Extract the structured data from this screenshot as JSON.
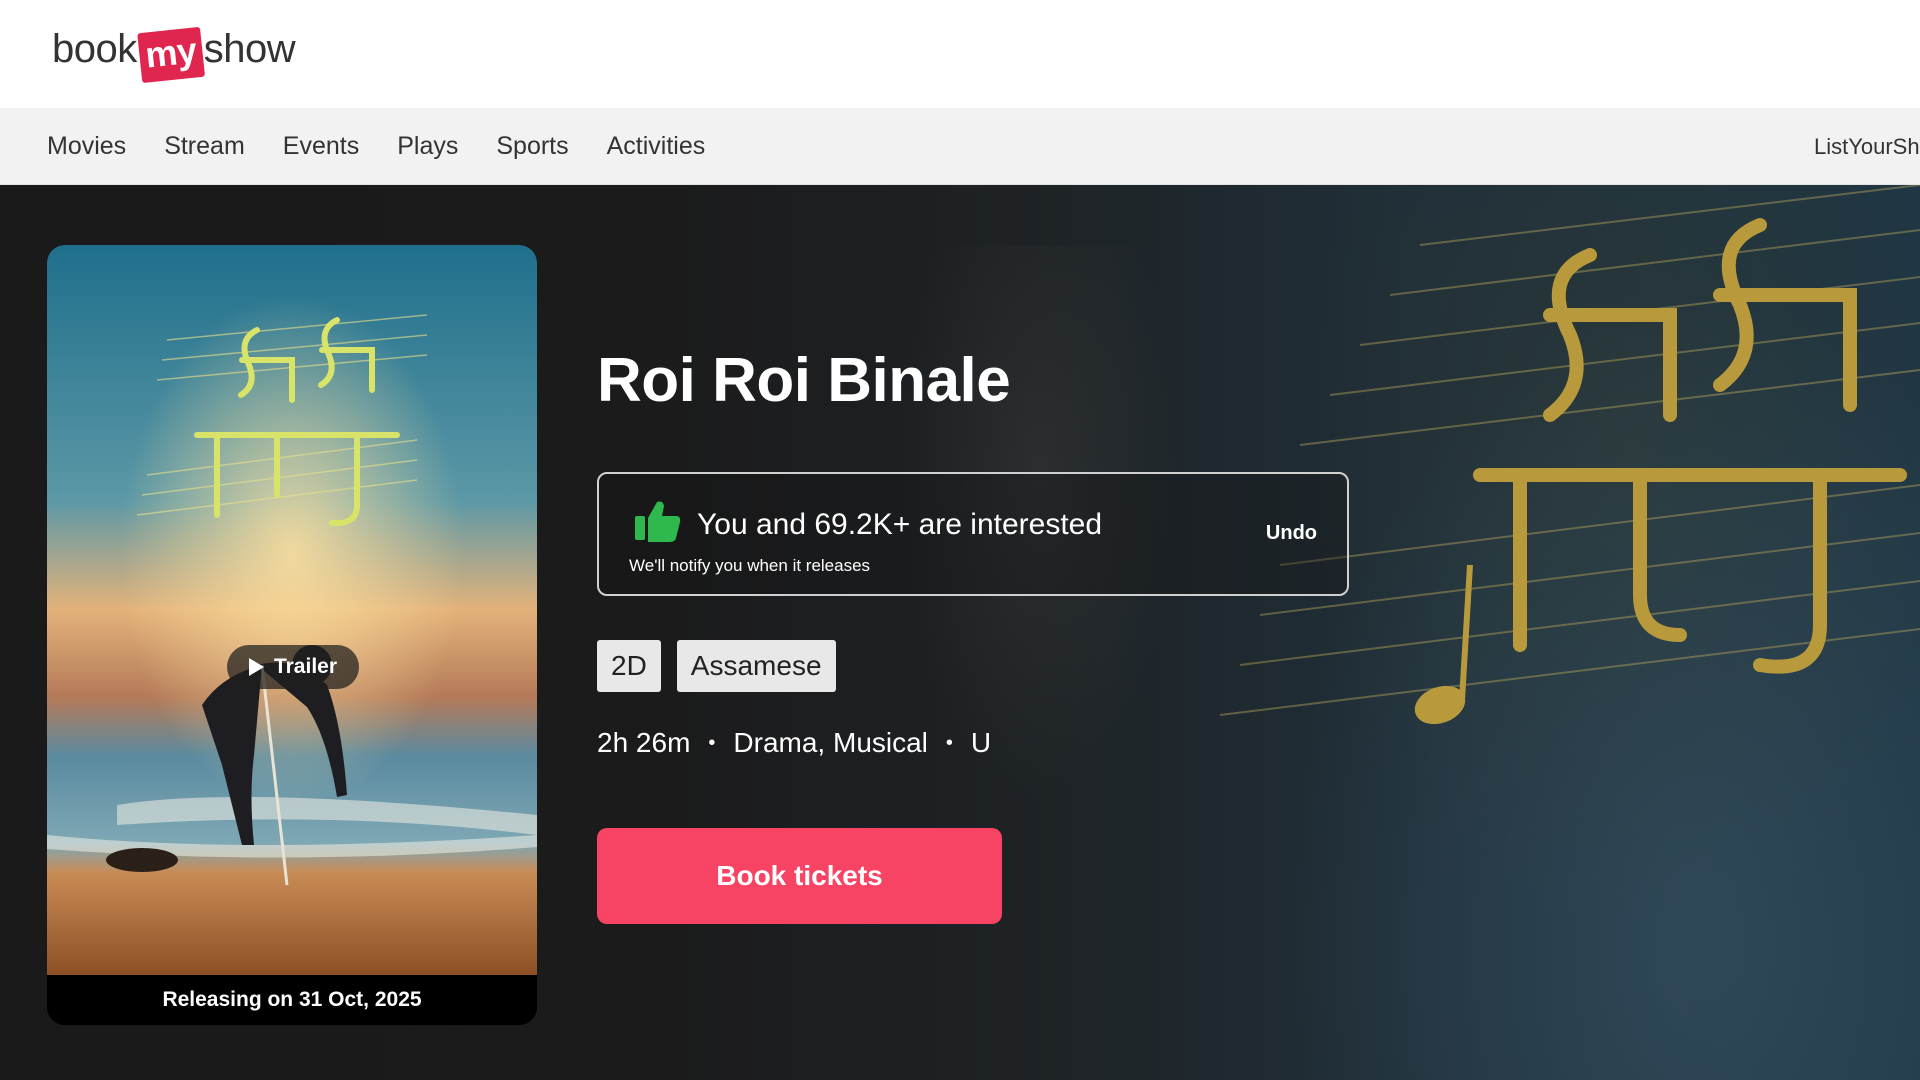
{
  "header": {
    "logo": {
      "part1": "book",
      "part2": "my",
      "part3": "show"
    }
  },
  "nav": {
    "items": [
      "Movies",
      "Stream",
      "Events",
      "Plays",
      "Sports",
      "Activities"
    ],
    "right_label": "ListYourSh"
  },
  "movie": {
    "title": "Roi Roi Binale",
    "trailer_label": "Trailer",
    "release_text": "Releasing on 31 Oct, 2025",
    "interest": {
      "text": "You and 69.2K+ are interested",
      "subtext": "We'll notify you when it releases",
      "undo_label": "Undo"
    },
    "tags": [
      "2D",
      "Assamese"
    ],
    "meta": {
      "duration": "2h 26m",
      "genres": "Drama, Musical",
      "rating": "U",
      "separator": "•"
    },
    "book_label": "Book tickets"
  },
  "colors": {
    "brand": "#f84464",
    "logo_red": "#e0254f",
    "thumb_green": "#2eb84e",
    "hero_bg": "#1c1c1c"
  },
  "icons": [
    "play-icon",
    "thumbs-up-icon"
  ]
}
